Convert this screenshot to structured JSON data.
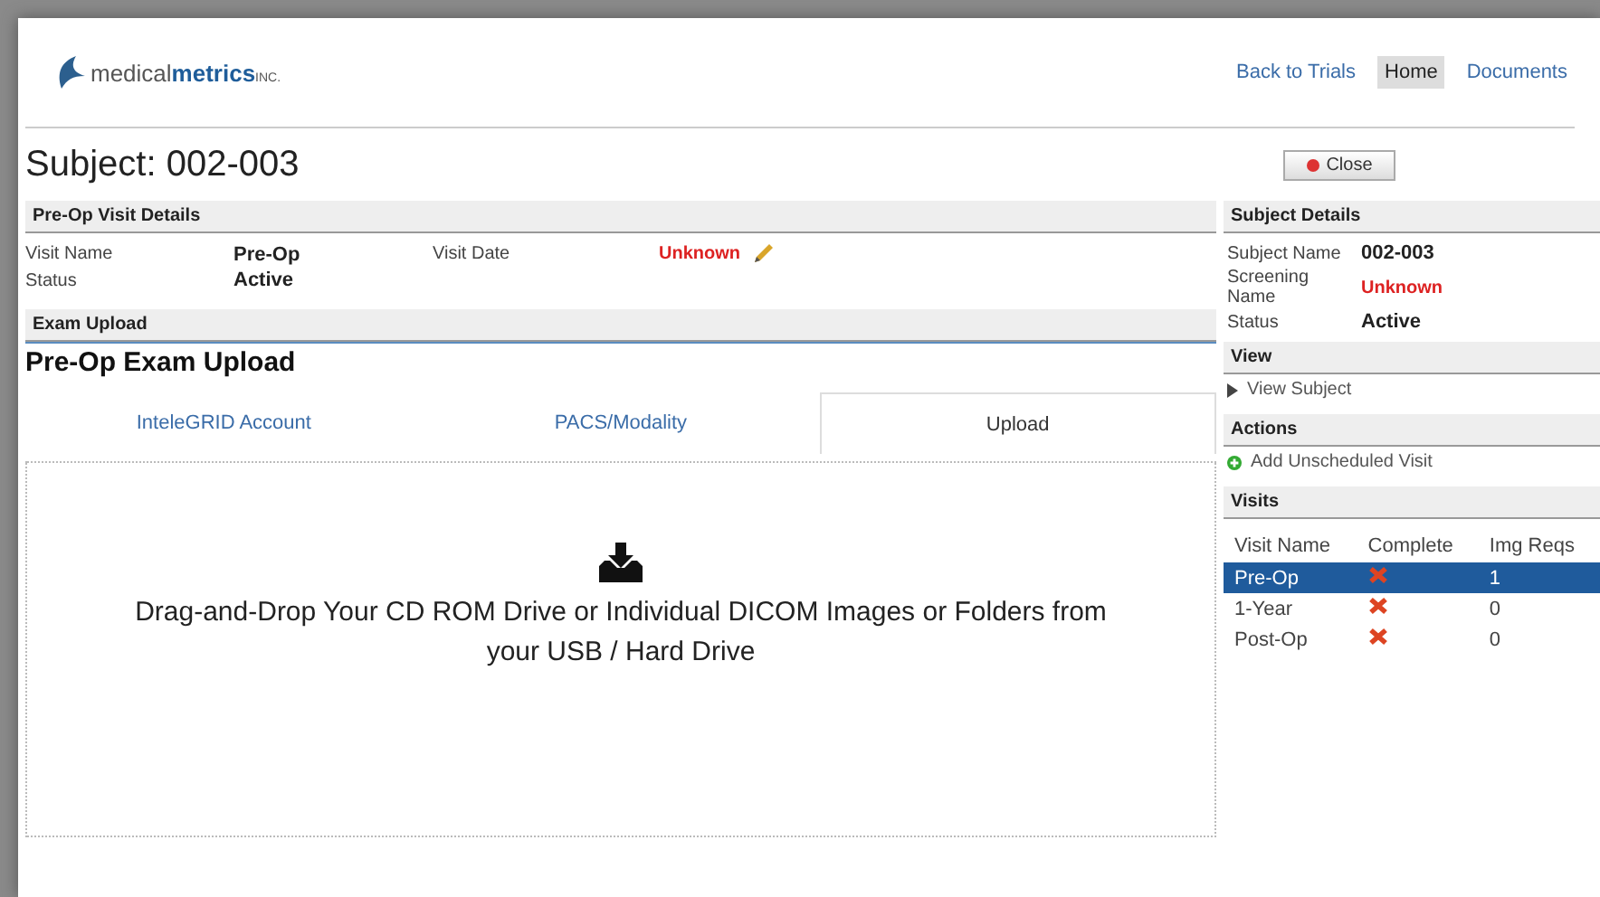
{
  "header": {
    "logo": {
      "part_1": "medical",
      "part_2": "metrics",
      "part_3": "INC."
    },
    "nav": [
      {
        "label": "Back to Trials",
        "selected": false
      },
      {
        "label": "Home",
        "selected": true
      },
      {
        "label": "Documents",
        "selected": false
      }
    ]
  },
  "title": "Subject: 002-003",
  "close_button": "Close",
  "visit_details": {
    "heading": "Pre-Op Visit Details",
    "fields": [
      {
        "label": "Visit Name",
        "value": "Pre-Op",
        "kind": "bold"
      },
      {
        "label": "Visit Date",
        "value": "Unknown",
        "kind": "unknown"
      },
      {
        "label": "Status",
        "value": "Active",
        "kind": "bold"
      }
    ]
  },
  "exam_upload": {
    "heading": "Exam Upload",
    "title": "Pre-Op Exam Upload",
    "tabs": [
      {
        "label": "InteleGRID Account",
        "selected": false
      },
      {
        "label": "PACS/Modality",
        "selected": false
      },
      {
        "label": "Upload",
        "selected": true
      }
    ],
    "dropzone_text": "Drag-and-Drop Your CD ROM Drive or Individual DICOM Images or Folders from your USB / Hard Drive"
  },
  "subject_details": {
    "heading": "Subject Details",
    "fields": [
      {
        "label": "Subject Name",
        "value": "002-003",
        "kind": "bold"
      },
      {
        "label": "Screening Name",
        "value": "Unknown",
        "kind": "unknown"
      },
      {
        "label": "Status",
        "value": "Active",
        "kind": "bold"
      }
    ]
  },
  "view": {
    "heading": "View",
    "link": "View Subject"
  },
  "actions": {
    "heading": "Actions",
    "link": "Add Unscheduled Visit"
  },
  "visits": {
    "heading": "Visits",
    "columns": [
      "Visit Name",
      "Complete",
      "Img Reqs"
    ],
    "rows": [
      {
        "name": "Pre-Op",
        "complete": false,
        "img_reqs": "1",
        "selected": true
      },
      {
        "name": "1-Year",
        "complete": false,
        "img_reqs": "0",
        "selected": false
      },
      {
        "name": "Post-Op",
        "complete": false,
        "img_reqs": "0",
        "selected": false
      }
    ]
  }
}
